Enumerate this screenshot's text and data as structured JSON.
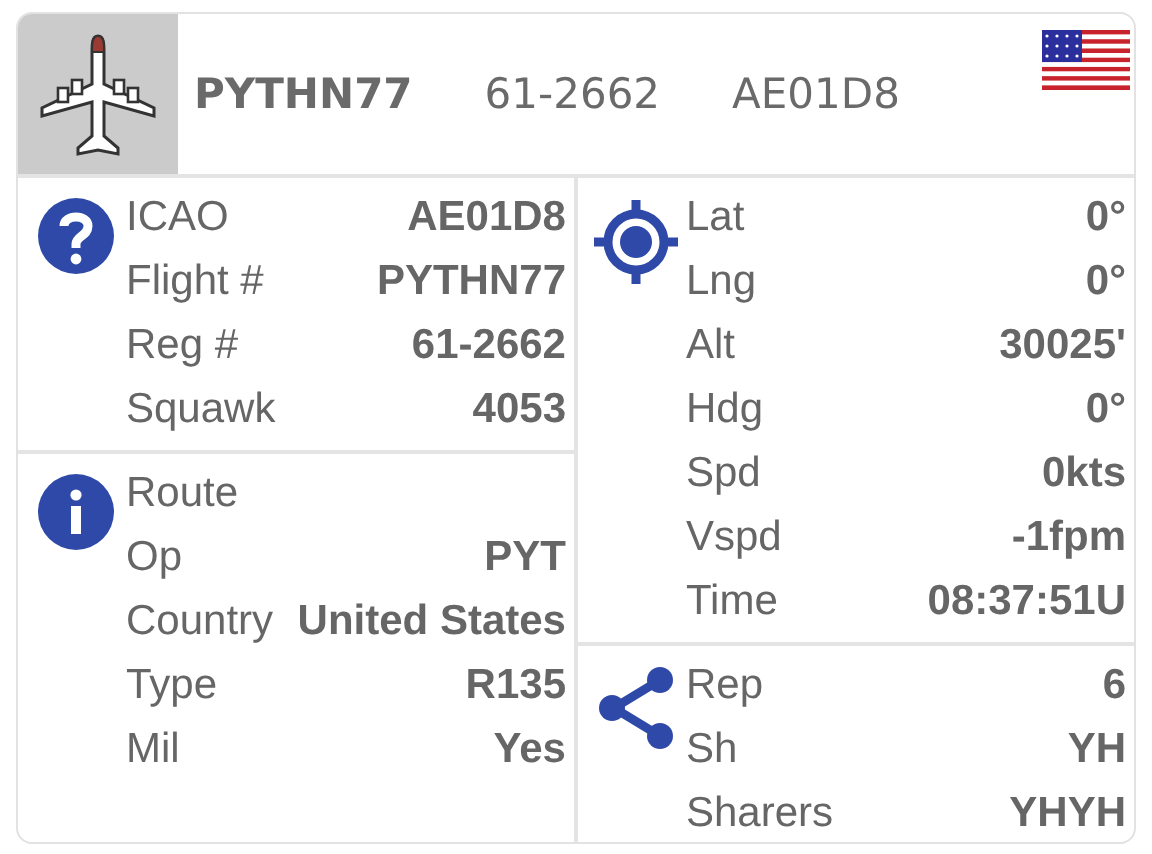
{
  "header": {
    "callsign": "PYTHN77",
    "registration": "61-2662",
    "icao": "AE01D8"
  },
  "columns": [
    {
      "sections": [
        {
          "kind": "help",
          "rows": [
            {
              "label": "ICAO",
              "value": "AE01D8"
            },
            {
              "label": "Flight #",
              "value": "PYTHN77"
            },
            {
              "label": "Reg #",
              "value": "61-2662"
            },
            {
              "label": "Squawk",
              "value": "4053"
            }
          ]
        },
        {
          "kind": "info",
          "rows": [
            {
              "label": "Route"
            },
            {
              "label": "Op",
              "value": "PYT"
            },
            {
              "label": "Country",
              "value": "United States"
            },
            {
              "label": "Type",
              "value": "R135"
            },
            {
              "label": "Mil",
              "value": "Yes"
            }
          ]
        }
      ]
    },
    {
      "sections": [
        {
          "kind": "location",
          "rows": [
            {
              "label": "Lat",
              "value": "0°"
            },
            {
              "label": "Lng",
              "value": "0°"
            },
            {
              "label": "Alt",
              "value": "30025'"
            },
            {
              "label": "Hdg",
              "value": "0°"
            },
            {
              "label": "Spd",
              "value": "0kts"
            },
            {
              "label": "Vspd",
              "value": "-1fpm"
            },
            {
              "label": "Time",
              "value": "08:37:51U"
            }
          ]
        },
        {
          "kind": "share",
          "rows": [
            {
              "label": "Rep",
              "value": "6"
            },
            {
              "label": "Sh",
              "value": "YH"
            },
            {
              "label": "Sharers",
              "value": "YHYH"
            }
          ]
        }
      ]
    }
  ]
}
